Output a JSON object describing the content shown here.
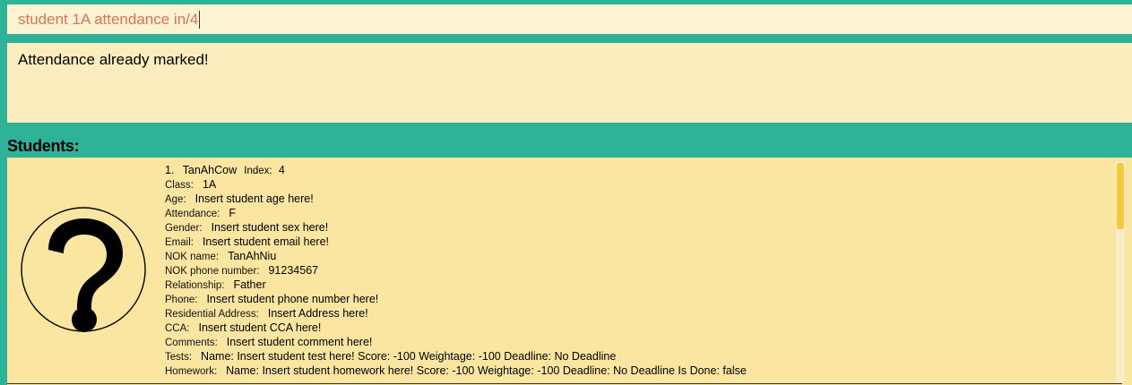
{
  "command": {
    "value": "student 1A attendance in/4"
  },
  "result": {
    "message": "Attendance already marked!"
  },
  "students_panel": {
    "title": "Students:"
  },
  "student_card": {
    "position": "1.",
    "name": "TanAhCow",
    "index_label": "Index:",
    "index_value": "4",
    "avatar_icon": "question-mark-icon",
    "fields": [
      {
        "label": "Class:",
        "value": "1A"
      },
      {
        "label": "Age:",
        "value": "Insert student age here!"
      },
      {
        "label": "Attendance:",
        "value": "F"
      },
      {
        "label": "Gender:",
        "value": "Insert student sex here!"
      },
      {
        "label": "Email:",
        "value": "Insert student email here!"
      },
      {
        "label": "NOK name:",
        "value": "TanAhNiu"
      },
      {
        "label": "NOK phone number:",
        "value": "91234567"
      },
      {
        "label": "Relationship:",
        "value": "Father"
      },
      {
        "label": "Phone:",
        "value": "Insert student phone number here!"
      },
      {
        "label": "Residential Address:",
        "value": "Insert Address here!"
      },
      {
        "label": "CCA:",
        "value": "Insert student CCA here!"
      },
      {
        "label": "Comments:",
        "value": "Insert student comment here!"
      },
      {
        "label": "Tests:",
        "value": "Name: Insert student test here! Score: -100 Weightage: -100 Deadline: No Deadline"
      },
      {
        "label": "Homework:",
        "value": "Name: Insert student homework here! Score: -100 Weightage: -100 Deadline: No Deadline Is Done: false"
      }
    ]
  },
  "colors": {
    "accent": "#2EB398",
    "command_bg": "#FCF3D2",
    "command_text": "#D9735A",
    "result_bg": "#FBEDBD",
    "list_bg": "#FBE6A1",
    "scroll_thumb": "#F4C842"
  }
}
